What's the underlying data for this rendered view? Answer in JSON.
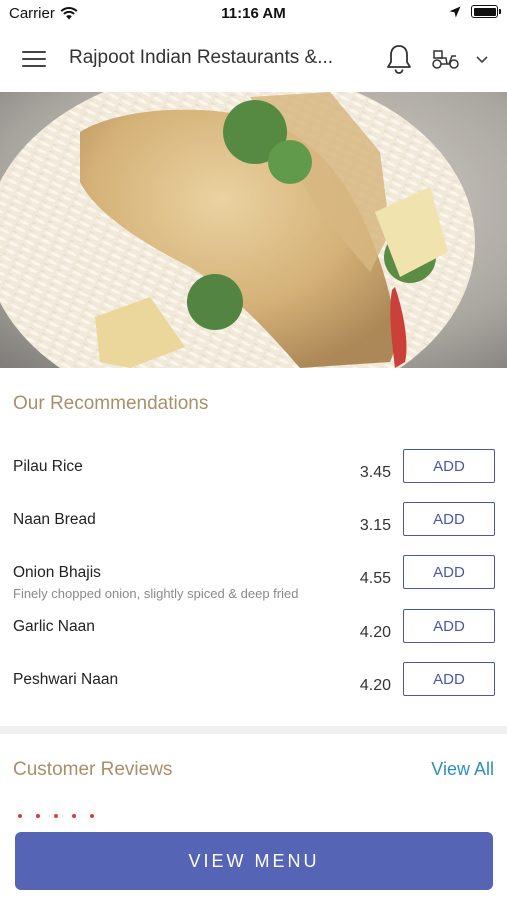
{
  "status_bar": {
    "carrier": "Carrier",
    "time": "11:16 AM",
    "battery_level": 1.0
  },
  "header": {
    "title": "Rajpoot Indian Restaurants &...",
    "icons": [
      "menu-icon",
      "bell-icon",
      "scooter-icon",
      "chevron-down-icon"
    ]
  },
  "recommendations": {
    "title": "Our Recommendations",
    "items": [
      {
        "name": "Pilau Rice",
        "description": "",
        "price": "3.45",
        "add_label": "ADD"
      },
      {
        "name": "Naan Bread",
        "description": "",
        "price": "3.15",
        "add_label": "ADD"
      },
      {
        "name": "Onion Bhajis",
        "description": "Finely chopped onion, slightly spiced & deep fried",
        "price": "4.55",
        "add_label": "ADD"
      },
      {
        "name": "Garlic Naan",
        "description": "",
        "price": "4.20",
        "add_label": "ADD"
      },
      {
        "name": "Peshwari Naan",
        "description": "",
        "price": "4.20",
        "add_label": "ADD"
      }
    ]
  },
  "reviews": {
    "title": "Customer Reviews",
    "view_all_label": "View All",
    "stars": 5
  },
  "footer": {
    "view_menu_label": "VIEW MENU"
  },
  "colors": {
    "accent": "#5564b5",
    "section_title": "#a7906a",
    "link": "#2d8fc0",
    "star": "#e23c35"
  }
}
